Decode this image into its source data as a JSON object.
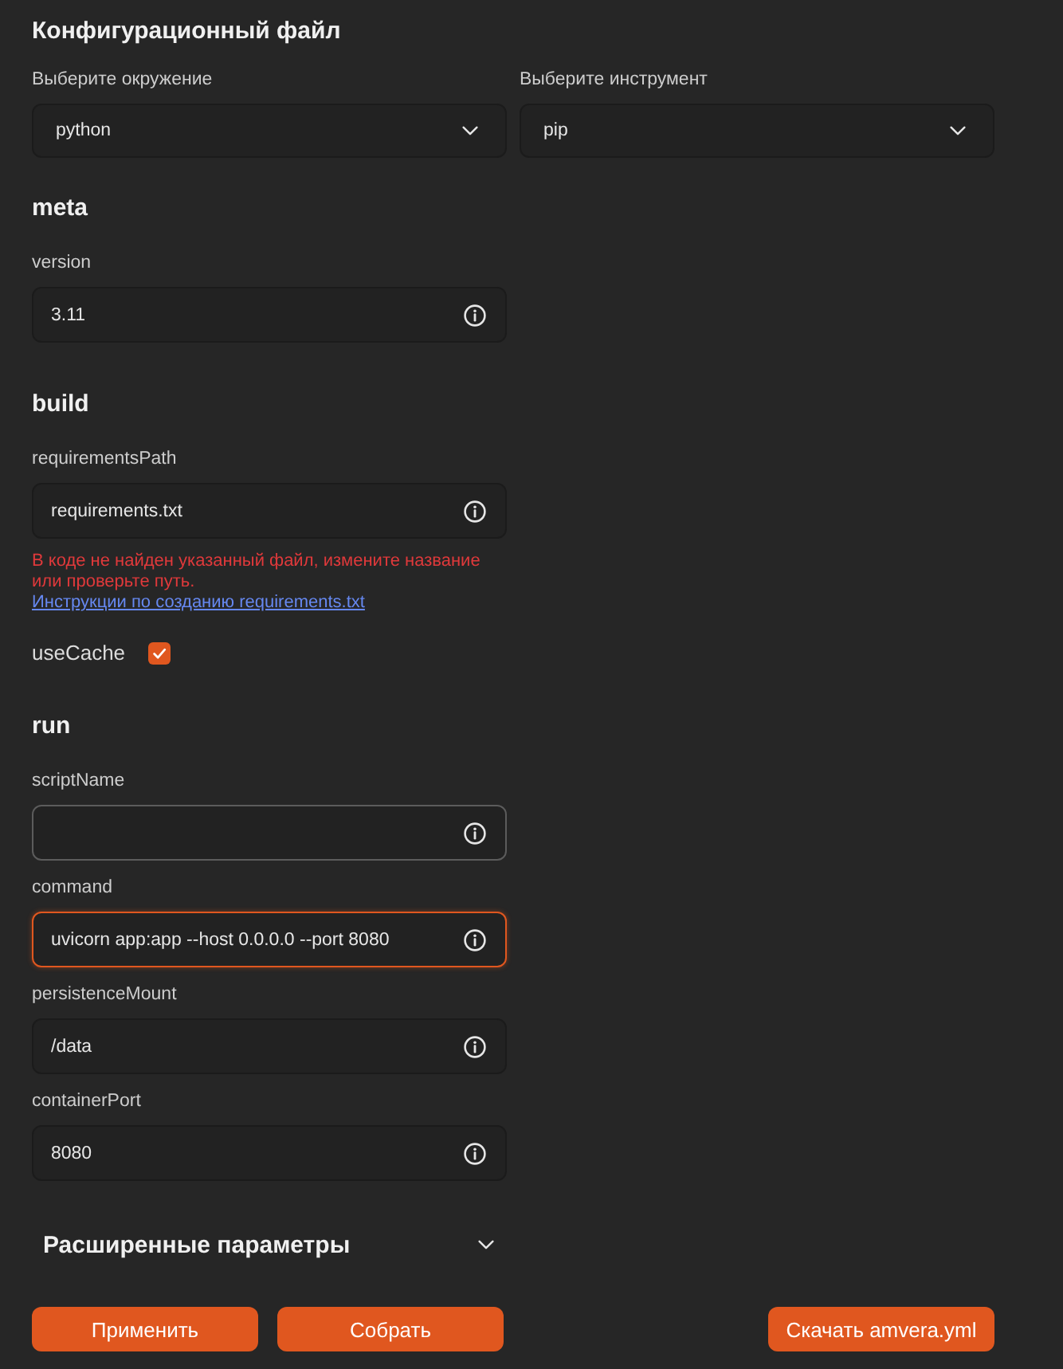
{
  "title": "Конфигурационный файл",
  "selects": [
    {
      "label": "Выберите окружение",
      "value": "python"
    },
    {
      "label": "Выберите инструмент",
      "value": "pip"
    }
  ],
  "sections": [
    {
      "heading": "meta",
      "items": [
        {
          "kind": "field",
          "label": "version",
          "value": "3.11",
          "focused": false,
          "hovered": false
        }
      ]
    },
    {
      "heading": "build",
      "items": [
        {
          "kind": "field",
          "label": "requirementsPath",
          "value": "requirements.txt",
          "focused": false,
          "hovered": false,
          "error": "В коде не найден указанный файл, измените название или проверьте путь.",
          "error_link": "Инструкции по созданию requirements.txt"
        },
        {
          "kind": "checkbox",
          "label": "useCache",
          "checked": true
        }
      ]
    },
    {
      "heading": "run",
      "items": [
        {
          "kind": "field",
          "label": "scriptName",
          "focused": false,
          "hovered": true
        },
        {
          "kind": "field",
          "label": "command",
          "value": "uvicorn app:app --host 0.0.0.0 --port 8080",
          "focused": true,
          "hovered": false
        },
        {
          "kind": "field",
          "label": "persistenceMount",
          "value": "/data",
          "focused": false,
          "hovered": false
        },
        {
          "kind": "field",
          "label": "containerPort",
          "value": "8080",
          "focused": false,
          "hovered": false
        }
      ]
    }
  ],
  "advanced": {
    "label": "Расширенные параметры",
    "expanded": false
  },
  "actions": [
    "Применить",
    "Собрать"
  ],
  "download_button": "Скачать amvera.yml"
}
